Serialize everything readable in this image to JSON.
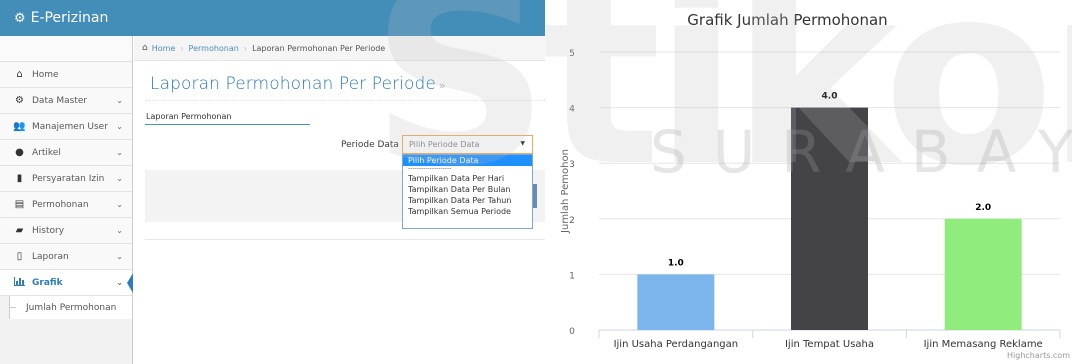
{
  "app": {
    "brand": "E-Perizinan",
    "brand_icon": "cogs-icon"
  },
  "sidebar": {
    "items": [
      {
        "label": "Home",
        "icon": "home-icon",
        "has_chevron": false
      },
      {
        "label": "Data Master",
        "icon": "cogs-icon",
        "has_chevron": true
      },
      {
        "label": "Manajemen User",
        "icon": "users-icon",
        "has_chevron": true
      },
      {
        "label": "Artikel",
        "icon": "circle-icon",
        "has_chevron": true
      },
      {
        "label": "Persyaratan Izin",
        "icon": "bookmark-icon",
        "has_chevron": true
      },
      {
        "label": "Permohonan",
        "icon": "copy-icon",
        "has_chevron": true
      },
      {
        "label": "History",
        "icon": "book-icon",
        "has_chevron": true
      },
      {
        "label": "Laporan",
        "icon": "file-icon",
        "has_chevron": true
      },
      {
        "label": "Grafik",
        "icon": "bar-chart-icon",
        "has_chevron": true,
        "active": true
      }
    ],
    "sub_items": [
      {
        "label": "Jumlah Permohonan"
      }
    ]
  },
  "breadcrumb": {
    "home": "Home",
    "items": [
      "Permohonan",
      "Laporan Permohonan Per Periode"
    ]
  },
  "page": {
    "title": "Laporan Permohonan Per Periode",
    "title_suffix": "»",
    "tab": "Laporan Permohonan",
    "field_label": "Periode Data",
    "select_value": "Pilih Periode Data",
    "options": [
      "Pilih Periode Data",
      "--------------------",
      "Tampilkan Data Per Hari",
      "Tampilkan Data Per Bulan",
      "Tampilkan Data Per Tahun",
      "Tampilkan Semua Periode"
    ]
  },
  "colors": {
    "brand": "#438eb9",
    "accent": "#2679b5",
    "bar_1": "#7cb5ec",
    "bar_2": "#434348",
    "bar_3": "#90ed7d"
  },
  "chart_data": {
    "type": "bar",
    "title": "Grafik Jumlah Permohonan",
    "ylabel": "Jumlah Pemohon",
    "xlabel": "",
    "categories": [
      "Ijin Usaha Perdangangan",
      "Ijin Tempat Usaha",
      "Ijin Memasang Reklame"
    ],
    "values": [
      1.0,
      4.0,
      2.0
    ],
    "data_labels": [
      "1.0",
      "4.0",
      "2.0"
    ],
    "ylim": [
      0,
      5
    ],
    "yticks": [
      "0",
      "1",
      "2",
      "3",
      "4",
      "5"
    ],
    "grid": true,
    "legend": "none",
    "credits": "Highcharts.com"
  },
  "watermark": {
    "main": "Stikom",
    "sub": "SURABAYA"
  }
}
